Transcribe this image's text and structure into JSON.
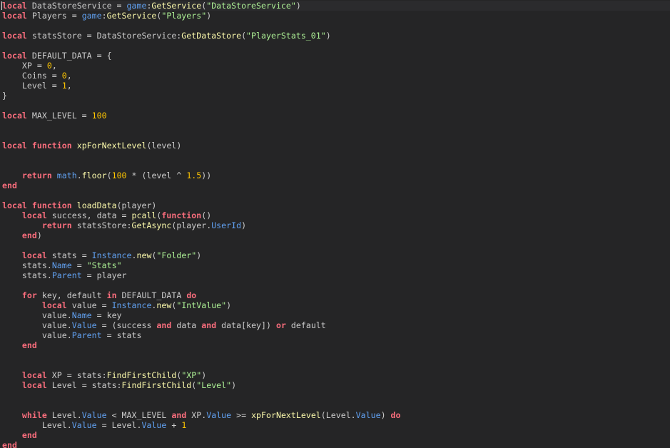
{
  "editor": {
    "colors": {
      "background": "#252526",
      "text": "#cccccc",
      "keyword": "#f86d7c",
      "function": "#fdfbac",
      "string": "#adf195",
      "number": "#ffc600",
      "property": "#61a1f1"
    },
    "lines": [
      [
        [
          "kw",
          "local"
        ],
        [
          "plain",
          " DataStoreService = "
        ],
        [
          "prop",
          "game"
        ],
        [
          "plain",
          ":"
        ],
        [
          "fn",
          "GetService"
        ],
        [
          "plain",
          "("
        ],
        [
          "str",
          "\"DataStoreService\""
        ],
        [
          "plain",
          ")"
        ]
      ],
      [
        [
          "kw",
          "local"
        ],
        [
          "plain",
          " Players = "
        ],
        [
          "prop",
          "game"
        ],
        [
          "plain",
          ":"
        ],
        [
          "fn",
          "GetService"
        ],
        [
          "plain",
          "("
        ],
        [
          "str",
          "\"Players\""
        ],
        [
          "plain",
          ")"
        ]
      ],
      [],
      [
        [
          "kw",
          "local"
        ],
        [
          "plain",
          " statsStore = DataStoreService:"
        ],
        [
          "fn",
          "GetDataStore"
        ],
        [
          "plain",
          "("
        ],
        [
          "str",
          "\"PlayerStats_01\""
        ],
        [
          "plain",
          ")"
        ]
      ],
      [],
      [
        [
          "kw",
          "local"
        ],
        [
          "plain",
          " DEFAULT_DATA = {"
        ]
      ],
      [
        [
          "plain",
          "    XP = "
        ],
        [
          "num",
          "0"
        ],
        [
          "plain",
          ","
        ]
      ],
      [
        [
          "plain",
          "    Coins = "
        ],
        [
          "num",
          "0"
        ],
        [
          "plain",
          ","
        ]
      ],
      [
        [
          "plain",
          "    Level = "
        ],
        [
          "num",
          "1"
        ],
        [
          "plain",
          ","
        ]
      ],
      [
        [
          "plain",
          "}"
        ]
      ],
      [],
      [
        [
          "kw",
          "local"
        ],
        [
          "plain",
          " MAX_LEVEL = "
        ],
        [
          "num",
          "100"
        ]
      ],
      [],
      [],
      [
        [
          "kw",
          "local"
        ],
        [
          "plain",
          " "
        ],
        [
          "kw",
          "function"
        ],
        [
          "plain",
          " "
        ],
        [
          "fn",
          "xpForNextLevel"
        ],
        [
          "plain",
          "(level)"
        ]
      ],
      [],
      [],
      [
        [
          "plain",
          "    "
        ],
        [
          "kw",
          "return"
        ],
        [
          "plain",
          " "
        ],
        [
          "prop",
          "math"
        ],
        [
          "plain",
          "."
        ],
        [
          "fn",
          "floor"
        ],
        [
          "plain",
          "("
        ],
        [
          "num",
          "100"
        ],
        [
          "plain",
          " * (level ^ "
        ],
        [
          "num",
          "1.5"
        ],
        [
          "plain",
          "))"
        ]
      ],
      [
        [
          "kw",
          "end"
        ]
      ],
      [],
      [
        [
          "kw",
          "local"
        ],
        [
          "plain",
          " "
        ],
        [
          "kw",
          "function"
        ],
        [
          "plain",
          " "
        ],
        [
          "fn",
          "loadData"
        ],
        [
          "plain",
          "(player)"
        ]
      ],
      [
        [
          "plain",
          "    "
        ],
        [
          "kw",
          "local"
        ],
        [
          "plain",
          " success, data = "
        ],
        [
          "fn",
          "pcall"
        ],
        [
          "plain",
          "("
        ],
        [
          "kw",
          "function"
        ],
        [
          "plain",
          "()"
        ]
      ],
      [
        [
          "plain",
          "        "
        ],
        [
          "kw",
          "return"
        ],
        [
          "plain",
          " statsStore:"
        ],
        [
          "fn",
          "GetAsync"
        ],
        [
          "plain",
          "(player."
        ],
        [
          "prop",
          "UserId"
        ],
        [
          "plain",
          ")"
        ]
      ],
      [
        [
          "plain",
          "    "
        ],
        [
          "kw",
          "end"
        ],
        [
          "plain",
          ")"
        ]
      ],
      [],
      [
        [
          "plain",
          "    "
        ],
        [
          "kw",
          "local"
        ],
        [
          "plain",
          " stats = "
        ],
        [
          "prop",
          "Instance"
        ],
        [
          "plain",
          "."
        ],
        [
          "fn",
          "new"
        ],
        [
          "plain",
          "("
        ],
        [
          "str",
          "\"Folder\""
        ],
        [
          "plain",
          ")"
        ]
      ],
      [
        [
          "plain",
          "    stats."
        ],
        [
          "prop",
          "Name"
        ],
        [
          "plain",
          " = "
        ],
        [
          "str",
          "\"Stats\""
        ]
      ],
      [
        [
          "plain",
          "    stats."
        ],
        [
          "prop",
          "Parent"
        ],
        [
          "plain",
          " = player"
        ]
      ],
      [],
      [
        [
          "plain",
          "    "
        ],
        [
          "kw",
          "for"
        ],
        [
          "plain",
          " key, default "
        ],
        [
          "kw",
          "in"
        ],
        [
          "plain",
          " DEFAULT_DATA "
        ],
        [
          "kw",
          "do"
        ]
      ],
      [
        [
          "plain",
          "        "
        ],
        [
          "kw",
          "local"
        ],
        [
          "plain",
          " value = "
        ],
        [
          "prop",
          "Instance"
        ],
        [
          "plain",
          "."
        ],
        [
          "fn",
          "new"
        ],
        [
          "plain",
          "("
        ],
        [
          "str",
          "\"IntValue\""
        ],
        [
          "plain",
          ")"
        ]
      ],
      [
        [
          "plain",
          "        value."
        ],
        [
          "prop",
          "Name"
        ],
        [
          "plain",
          " = key"
        ]
      ],
      [
        [
          "plain",
          "        value."
        ],
        [
          "prop",
          "Value"
        ],
        [
          "plain",
          " = (success "
        ],
        [
          "kw",
          "and"
        ],
        [
          "plain",
          " data "
        ],
        [
          "kw",
          "and"
        ],
        [
          "plain",
          " data[key]) "
        ],
        [
          "kw",
          "or"
        ],
        [
          "plain",
          " default"
        ]
      ],
      [
        [
          "plain",
          "        value."
        ],
        [
          "prop",
          "Parent"
        ],
        [
          "plain",
          " = stats"
        ]
      ],
      [
        [
          "plain",
          "    "
        ],
        [
          "kw",
          "end"
        ]
      ],
      [],
      [],
      [
        [
          "plain",
          "    "
        ],
        [
          "kw",
          "local"
        ],
        [
          "plain",
          " XP = stats:"
        ],
        [
          "fn",
          "FindFirstChild"
        ],
        [
          "plain",
          "("
        ],
        [
          "str",
          "\"XP\""
        ],
        [
          "plain",
          ")"
        ]
      ],
      [
        [
          "plain",
          "    "
        ],
        [
          "kw",
          "local"
        ],
        [
          "plain",
          " Level = stats:"
        ],
        [
          "fn",
          "FindFirstChild"
        ],
        [
          "plain",
          "("
        ],
        [
          "str",
          "\"Level\""
        ],
        [
          "plain",
          ")"
        ]
      ],
      [],
      [],
      [
        [
          "plain",
          "    "
        ],
        [
          "kw",
          "while"
        ],
        [
          "plain",
          " Level."
        ],
        [
          "prop",
          "Value"
        ],
        [
          "plain",
          " < MAX_LEVEL "
        ],
        [
          "kw",
          "and"
        ],
        [
          "plain",
          " XP."
        ],
        [
          "prop",
          "Value"
        ],
        [
          "plain",
          " >= "
        ],
        [
          "fn",
          "xpForNextLevel"
        ],
        [
          "plain",
          "(Level."
        ],
        [
          "prop",
          "Value"
        ],
        [
          "plain",
          ") "
        ],
        [
          "kw",
          "do"
        ]
      ],
      [
        [
          "plain",
          "        Level."
        ],
        [
          "prop",
          "Value"
        ],
        [
          "plain",
          " = Level."
        ],
        [
          "prop",
          "Value"
        ],
        [
          "plain",
          " + "
        ],
        [
          "num",
          "1"
        ]
      ],
      [
        [
          "plain",
          "    "
        ],
        [
          "kw",
          "end"
        ]
      ],
      [
        [
          "kw",
          "end"
        ]
      ]
    ]
  }
}
